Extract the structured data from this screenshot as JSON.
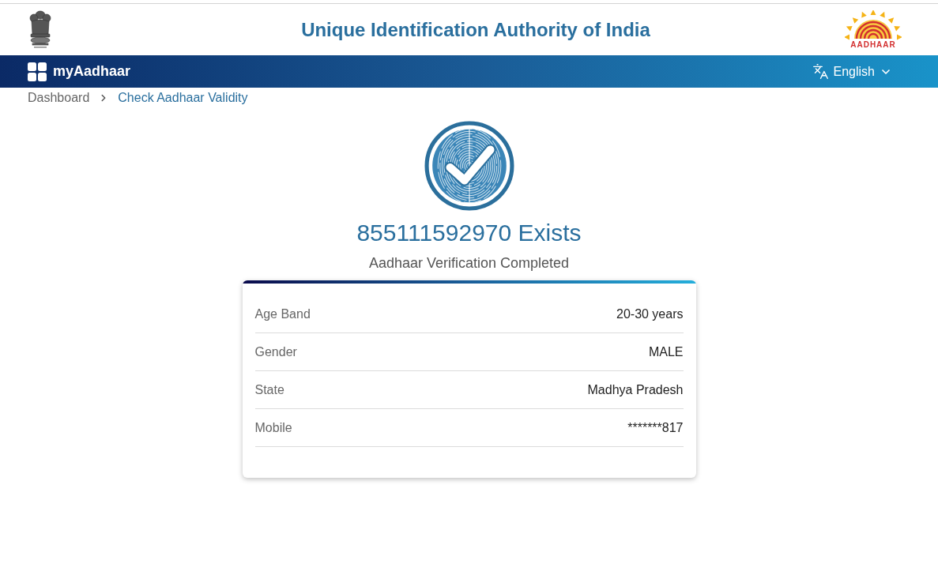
{
  "header": {
    "title": "Unique Identification Authority of India",
    "logo_text": "AADHAAR"
  },
  "navbar": {
    "brand": "myAadhaar",
    "language": "English"
  },
  "breadcrumb": [
    {
      "label": "Dashboard",
      "current": false
    },
    {
      "label": "Check Aadhaar Validity",
      "current": true
    }
  ],
  "result": {
    "heading": "855111592970 Exists",
    "subheading": "Aadhaar Verification Completed"
  },
  "details": [
    {
      "label": "Age Band",
      "value": "20-30 years"
    },
    {
      "label": "Gender",
      "value": "MALE"
    },
    {
      "label": "State",
      "value": "Madhya Pradesh"
    },
    {
      "label": "Mobile",
      "value": "*******817"
    }
  ]
}
